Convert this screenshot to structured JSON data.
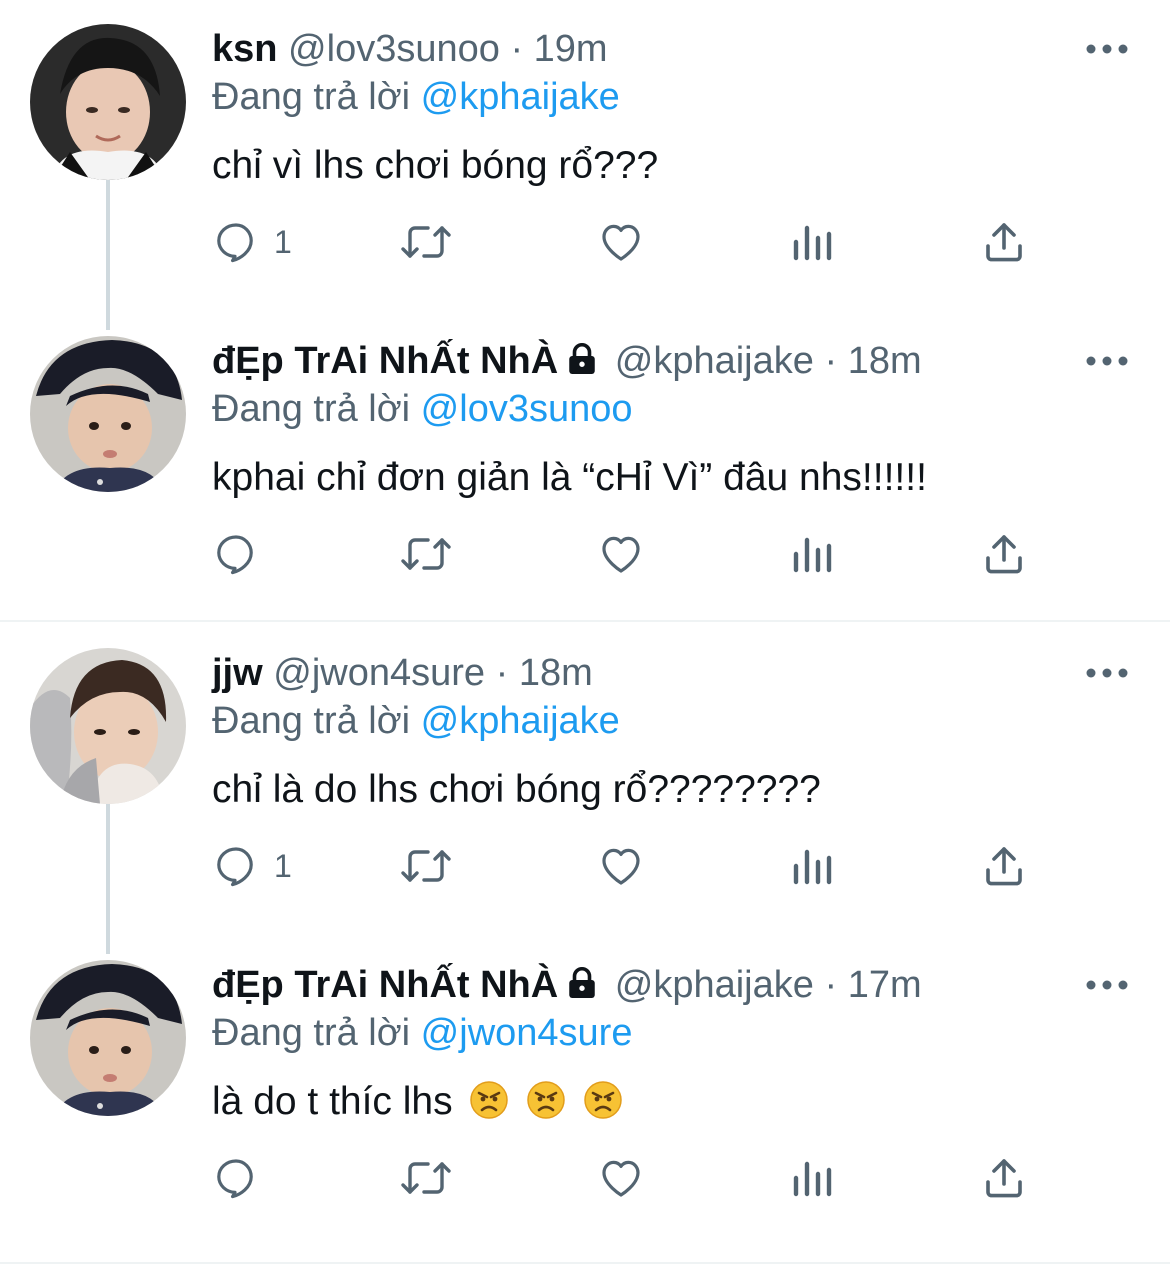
{
  "reply_prefix": "Đang trả lời",
  "tweets": [
    {
      "name": "ksn",
      "handle": "@lov3sunoo",
      "separator": "·",
      "time": "19m",
      "reply_to": "@kphaijake",
      "text": "chỉ vì lhs chơi bóng rổ???",
      "reply_count": "1",
      "locked": false
    },
    {
      "name": "đẸp TrAi NhẤt NhÀ",
      "handle": "@kphaijake",
      "separator": "·",
      "time": "18m",
      "reply_to": "@lov3sunoo",
      "text": "kphai chỉ đơn giản là “cHỉ Vì” đâu nhs!!!!!!",
      "reply_count": "",
      "locked": true
    },
    {
      "name": "jjw",
      "handle": "@jwon4sure",
      "separator": "·",
      "time": "18m",
      "reply_to": "@kphaijake",
      "text": "chỉ là do lhs chơi bóng rổ????????",
      "reply_count": "1",
      "locked": false
    },
    {
      "name": "đẸp TrAi NhẤt NhÀ",
      "handle": "@kphaijake",
      "separator": "·",
      "time": "17m",
      "reply_to": "@jwon4sure",
      "text": "là do t thíc lhs",
      "reply_count": "",
      "locked": true,
      "emojis": [
        "angry-face",
        "angry-face",
        "angry-face"
      ]
    }
  ],
  "colors": {
    "link": "#1d9bf0",
    "secondary": "#536471",
    "primary": "#0f1419",
    "thread_line": "#cfd9de"
  }
}
